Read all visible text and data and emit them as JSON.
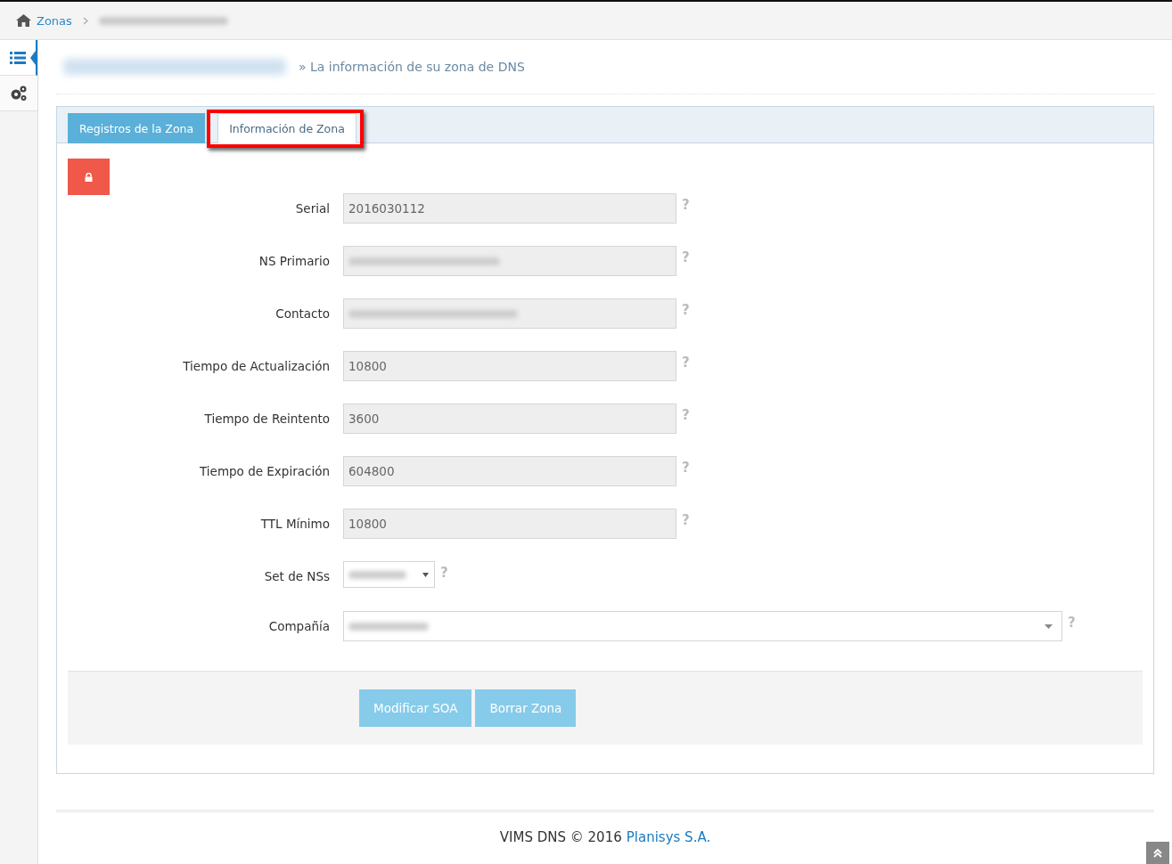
{
  "breadcrumb": {
    "items": [
      {
        "label": "Zonas",
        "redacted": false
      },
      {
        "redacted": true
      }
    ]
  },
  "sidebar": {
    "items": [
      {
        "selected": true
      },
      {
        "selected": false
      }
    ]
  },
  "heading": {
    "title_redacted": true,
    "subtitle": "» La información de su zona de DNS"
  },
  "tabs": [
    {
      "label": "Registros de la Zona",
      "selected": false,
      "highlighted": false
    },
    {
      "label": "Información de Zona",
      "selected": true,
      "highlighted": true
    }
  ],
  "lock_button": {
    "locked": true
  },
  "fields": [
    {
      "kind": "text",
      "label": "Serial",
      "value": "2016030112",
      "redacted": false,
      "disabled": true
    },
    {
      "kind": "text",
      "label": "NS Primario",
      "redacted": true,
      "disabled": true
    },
    {
      "kind": "text",
      "label": "Contacto",
      "redacted": true,
      "disabled": true
    },
    {
      "kind": "text",
      "label": "Tiempo de Actualización",
      "value": "10800",
      "redacted": false,
      "disabled": true
    },
    {
      "kind": "text",
      "label": "Tiempo de Reintento",
      "value": "3600",
      "redacted": false,
      "disabled": true
    },
    {
      "kind": "text",
      "label": "Tiempo de Expiración",
      "value": "604800",
      "redacted": false,
      "disabled": true
    },
    {
      "kind": "text",
      "label": "TTL Mínimo",
      "value": "10800",
      "redacted": false,
      "disabled": true
    },
    {
      "kind": "select",
      "label": "Set de NSs",
      "redacted": true,
      "disabled": false
    },
    {
      "kind": "combo",
      "label": "Compañía",
      "redacted": true,
      "disabled": false
    }
  ],
  "help_mark": "?",
  "buttons": [
    "Modificar SOA",
    "Borrar Zona"
  ],
  "footer": {
    "text": "VIMS DNS © 2016",
    "link": "Planisys S.A."
  }
}
